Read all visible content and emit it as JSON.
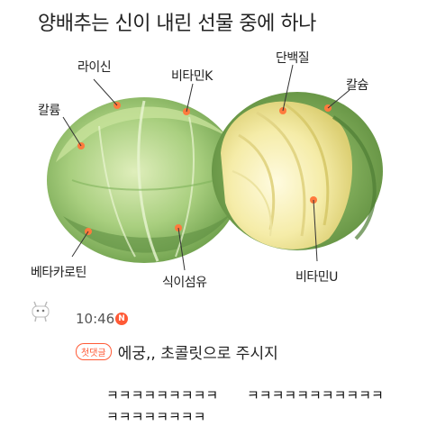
{
  "header": {
    "title": "양배추는 신이 내린 선물 중에 하나"
  },
  "image": {
    "labels": {
      "lysine": "라이신",
      "vitamin_k": "비타민K",
      "protein": "단백질",
      "calcium_right": "칼슘",
      "potassium": "칼륨",
      "beta_carotene": "베타카로틴",
      "dietary_fiber": "식이섬유",
      "vitamin_u": "비타민U"
    },
    "accent_color": "#ff7a3d"
  },
  "comment": {
    "time": "10:46",
    "new_badge": "N",
    "first_comment_badge": "첫댓글",
    "text": "에궁,, 초콜릿으로 주시지"
  },
  "reply": {
    "line1_left": "ㅋㅋㅋㅋㅋㅋㅋㅋㅋ",
    "line1_right": "ㅋㅋㅋㅋㅋㅋㅋㅋㅋㅋㅋ",
    "line2": "ㅋㅋㅋㅋㅋㅋㅋㅋ"
  }
}
